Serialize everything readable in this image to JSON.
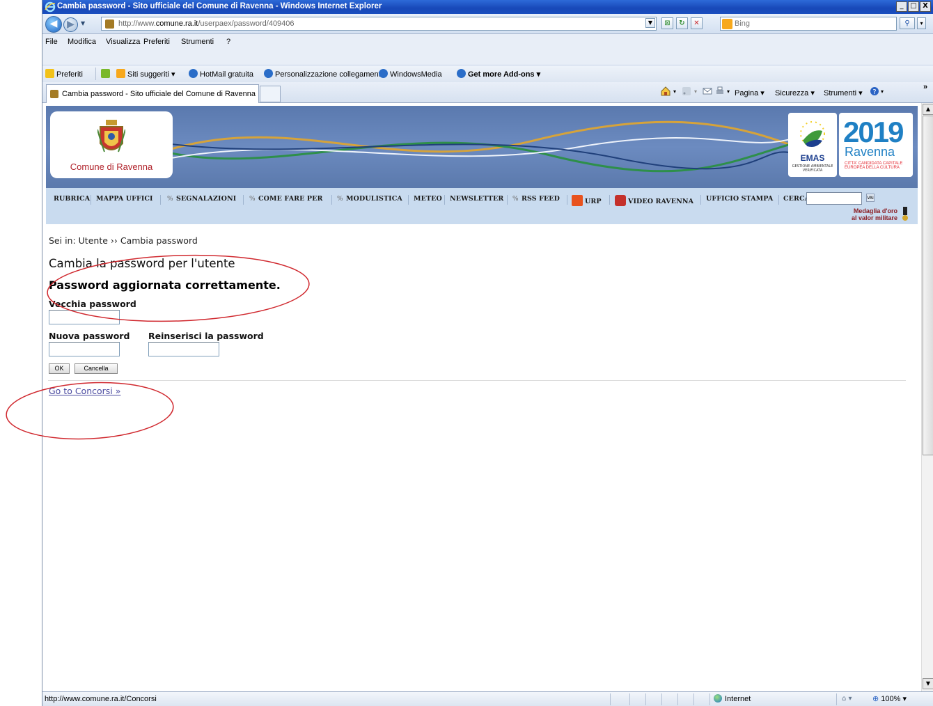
{
  "window": {
    "title": "Cambia password - Sito ufficiale del Comune di Ravenna - Windows Internet Explorer",
    "minimize": "_",
    "maximize": "□",
    "close": "X"
  },
  "navbar": {
    "url_prefix": "http://www.",
    "url_host": "comune.ra.it",
    "url_path": "/userpaex/password/409406",
    "search_placeholder": "Bing"
  },
  "menubar": {
    "items": [
      "File",
      "Modifica",
      "Visualizza",
      "Preferiti",
      "Strumenti",
      "?"
    ]
  },
  "favorites": {
    "label": "Preferiti",
    "items": [
      "Siti suggeriti ▾",
      "HotMail gratuita",
      "Personalizzazione collegamenti",
      "WindowsMedia",
      "Get more Add-ons ▾"
    ]
  },
  "tabs": {
    "active_title": "Cambia password - Sito ufficiale del Comune di Ravenna"
  },
  "commandbar": {
    "items": [
      "Pagina ▾",
      "Sicurezza ▾",
      "Strumenti ▾"
    ],
    "more": "»"
  },
  "site_header": {
    "city_name": "Comune di Ravenna",
    "emas_label": "EMAS",
    "emas_sub": "GESTIONE AMBIENTALE VERIFICATA",
    "ravenna_year": "2019",
    "ravenna_city": "Ravenna",
    "ravenna_candidacy": "CITTA' CANDIDATA CAPITALE EUROPEA DELLA CULTURA"
  },
  "mainnav": {
    "items": [
      "RUBRICA",
      "MAPPA UFFICI",
      "SEGNALAZIONI",
      "COME FARE PER",
      "MODULISTICA",
      "METEO",
      "NEWSLETTER",
      "RSS FEED",
      "URP",
      "VIDEO RAVENNA",
      "UFFICIO STAMPA",
      "CERCA"
    ],
    "search_button": "VAI",
    "medal_line1": "Medaglia d'oro",
    "medal_line2": "al valor militare"
  },
  "content": {
    "breadcrumb": "Sei in: Utente ›› Cambia password",
    "page_title": "Cambia la password per l'utente",
    "success_message": "Password aggiornata correttamente.",
    "old_password_label": "Vecchia password",
    "new_password_label": "Nuova password",
    "repeat_password_label": "Reinserisci la password",
    "ok_button": "OK",
    "cancel_button": "Cancella",
    "concorsi_link": "Go to Concorsi »"
  },
  "statusbar": {
    "status_text": "http://www.comune.ra.it/Concorsi",
    "zone": "Internet",
    "zoom": "100%"
  },
  "colors": {
    "annotation": "#d0282e",
    "nav_background": "#c9dbef",
    "header_background": "#6c8bc0",
    "link": "#4a4aa0"
  }
}
